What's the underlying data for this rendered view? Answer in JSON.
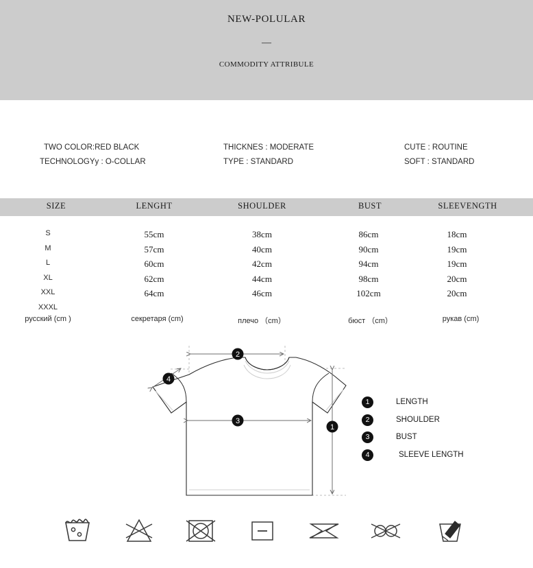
{
  "header": {
    "brand": "NEW-POLULAR",
    "divider": "—",
    "subtitle": "COMMODITY ATTRIBULE",
    "banner_color": "#cccccc"
  },
  "attributes": {
    "columns": [
      {
        "lines": [
          "TWO COLOR:RED BLACK",
          "TECHNOLOGYy : O-COLLAR"
        ]
      },
      {
        "lines": [
          "THICKNES : MODERATE",
          "TYPE : STANDARD"
        ]
      },
      {
        "lines": [
          "CUTE : ROUTINE",
          "SOFT : STANDARD"
        ]
      }
    ]
  },
  "size_table": {
    "header_color": "#cccccc",
    "headers": [
      "SIZE",
      "LENGHT",
      "SHOULDER",
      "BUST",
      "SLEEVENGTH"
    ],
    "rows": [
      {
        "size": "S",
        "length": "55cm",
        "shoulder": "38cm",
        "bust": "86cm",
        "sleeve": "18cm"
      },
      {
        "size": "M",
        "length": "57cm",
        "shoulder": "40cm",
        "bust": "90cm",
        "sleeve": "19cm"
      },
      {
        "size": "L",
        "length": "60cm",
        "shoulder": "42cm",
        "bust": "94cm",
        "sleeve": "19cm"
      },
      {
        "size": "XL",
        "length": "62cm",
        "shoulder": "44cm",
        "bust": "98cm",
        "sleeve": "20cm"
      },
      {
        "size": "XXL",
        "length": "64cm",
        "shoulder": "46cm",
        "bust": "102cm",
        "sleeve": "20cm"
      },
      {
        "size": "XXXL",
        "length": "",
        "shoulder": "",
        "bust": "",
        "sleeve": ""
      }
    ],
    "russian_labels": [
      "русский (cm )",
      "секретаря (cm)",
      "плечо （cm）",
      "бюст （cm）",
      "рукав (cm)"
    ]
  },
  "diagram": {
    "markers": {
      "length": "1",
      "shoulder": "2",
      "bust": "3",
      "sleeve": "4"
    },
    "legend": [
      {
        "num": "1",
        "label": "LENGTH"
      },
      {
        "num": "2",
        "label": "SHOULDER"
      },
      {
        "num": "3",
        "label": "BUST"
      },
      {
        "num": "4",
        "label": "SLEEVE LENGTH"
      }
    ]
  },
  "care_symbols": [
    {
      "name": "hand-wash-icon"
    },
    {
      "name": "do-not-bleach-icon"
    },
    {
      "name": "do-not-tumble-dry-icon"
    },
    {
      "name": "iron-low-heat-icon"
    },
    {
      "name": "do-not-wring-icon"
    },
    {
      "name": "do-not-dry-clean-icon"
    },
    {
      "name": "do-not-brush-icon"
    }
  ]
}
